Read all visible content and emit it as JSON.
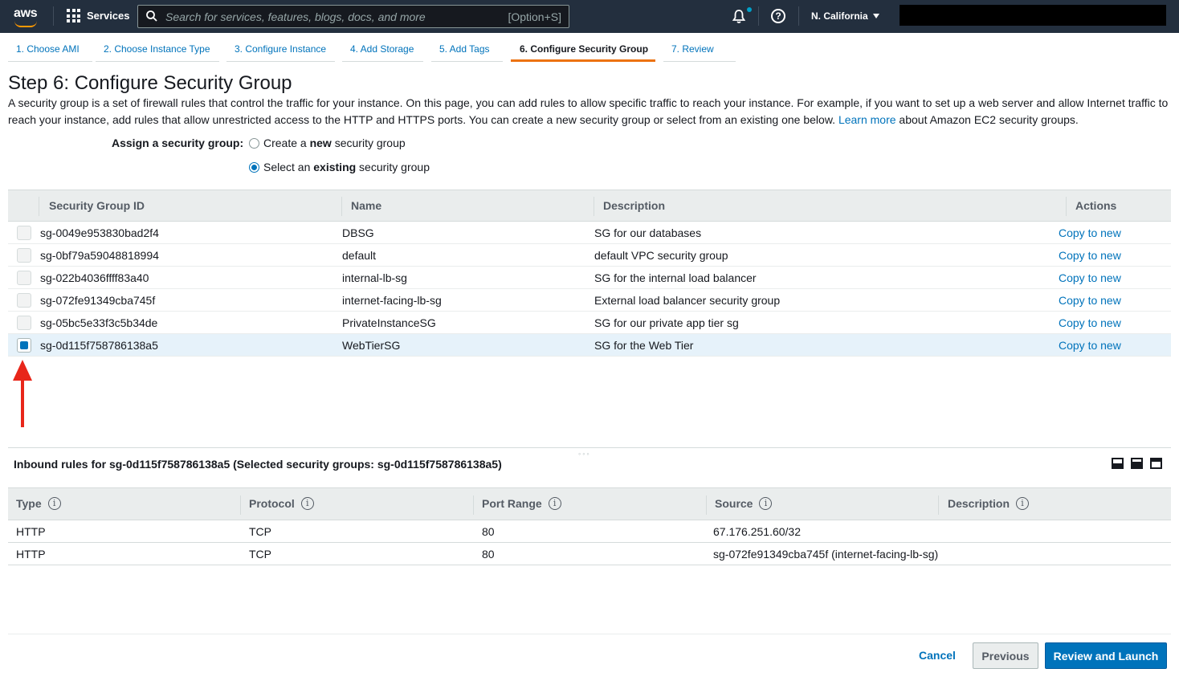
{
  "topnav": {
    "logo_text": "aws",
    "services_label": "Services",
    "search_placeholder": "Search for services, features, blogs, docs, and more",
    "search_shortcut": "[Option+S]",
    "help_glyph": "?",
    "region": "N. California"
  },
  "wizard_tabs": [
    {
      "label": "1. Choose AMI"
    },
    {
      "label": "2. Choose Instance Type"
    },
    {
      "label": "3. Configure Instance"
    },
    {
      "label": "4. Add Storage"
    },
    {
      "label": "5. Add Tags"
    },
    {
      "label": "6. Configure Security Group",
      "active": true
    },
    {
      "label": "7. Review"
    }
  ],
  "page": {
    "title": "Step 6: Configure Security Group",
    "intro_1": "A security group is a set of firewall rules that control the traffic for your instance. On this page, you can add rules to allow specific traffic to reach your instance. For example, if you want to set up a web server and allow Internet traffic to reach your instance, add rules that allow unrestricted access to the HTTP and HTTPS ports. You can create a new security group or select from an existing one below. ",
    "intro_link": "Learn more",
    "intro_2": " about Amazon EC2 security groups."
  },
  "assign": {
    "label": "Assign a security group:",
    "option_new_pre": "Create a ",
    "option_new_bold": "new",
    "option_new_post": " security group",
    "option_existing_pre": "Select an ",
    "option_existing_bold": "existing",
    "option_existing_post": " security group",
    "selected": "existing"
  },
  "sg_table": {
    "headers": {
      "id": "Security Group ID",
      "name": "Name",
      "description": "Description",
      "actions": "Actions"
    },
    "rows": [
      {
        "id": "sg-0049e953830bad2f4",
        "name": "DBSG",
        "description": "SG for our databases",
        "action": "Copy to new",
        "checked": false
      },
      {
        "id": "sg-0bf79a59048818994",
        "name": "default",
        "description": "default VPC security group",
        "action": "Copy to new",
        "checked": false
      },
      {
        "id": "sg-022b4036ffff83a40",
        "name": "internal-lb-sg",
        "description": "SG for the internal load balancer",
        "action": "Copy to new",
        "checked": false
      },
      {
        "id": "sg-072fe91349cba745f",
        "name": "internet-facing-lb-sg",
        "description": "External load balancer security group",
        "action": "Copy to new",
        "checked": false
      },
      {
        "id": "sg-05bc5e33f3c5b34de",
        "name": "PrivateInstanceSG",
        "description": "SG for our private app tier sg",
        "action": "Copy to new",
        "checked": false
      },
      {
        "id": "sg-0d115f758786138a5",
        "name": "WebTierSG",
        "description": "SG for the Web Tier",
        "action": "Copy to new",
        "checked": true
      }
    ]
  },
  "annotation": {
    "arrow_color": "#e8261a"
  },
  "inbound": {
    "grip": "◦◦◦",
    "title": "Inbound rules for sg-0d115f758786138a5 (Selected security groups: sg-0d115f758786138a5)",
    "info_glyph": "i",
    "headers": {
      "type": "Type",
      "protocol": "Protocol",
      "port_range": "Port Range",
      "source": "Source",
      "description": "Description"
    },
    "rows": [
      {
        "type": "HTTP",
        "protocol": "TCP",
        "port_range": "80",
        "source": "67.176.251.60/32",
        "description": ""
      },
      {
        "type": "HTTP",
        "protocol": "TCP",
        "port_range": "80",
        "source": "sg-072fe91349cba745f (internet-facing-lb-sg)",
        "description": ""
      }
    ]
  },
  "footer": {
    "cancel": "Cancel",
    "previous": "Previous",
    "review_launch": "Review and Launch"
  },
  "colors": {
    "nav_bg": "#232f3e",
    "accent": "#ec7211",
    "link": "#0073bb",
    "primary_button": "#0073bb"
  }
}
